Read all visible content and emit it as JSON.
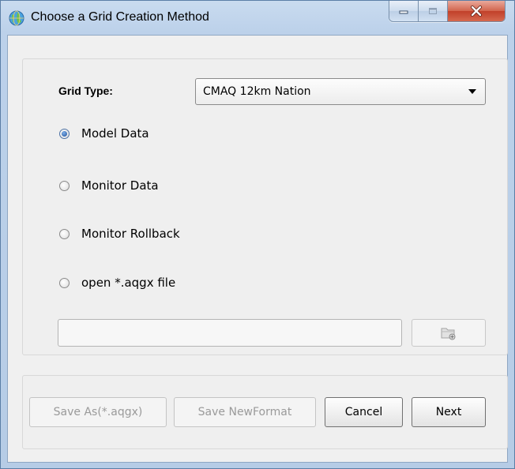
{
  "window": {
    "title": "Choose a Grid Creation Method",
    "icon": "globe-icon",
    "controls": [
      "minimize-icon",
      "maximize-icon",
      "close-icon"
    ]
  },
  "form": {
    "grid_type_label": "Grid Type:",
    "grid_type_value": "CMAQ 12km Nation",
    "options": [
      {
        "label": "Model Data",
        "checked": true
      },
      {
        "label": "Monitor Data",
        "checked": false
      },
      {
        "label": "Monitor Rollback",
        "checked": false
      },
      {
        "label": "open *.aqgx file",
        "checked": false
      }
    ],
    "file_path_value": "",
    "browse_icon": "folder-open-icon"
  },
  "buttons": {
    "save_as": {
      "label": "Save As(*.aqgx)",
      "enabled": false
    },
    "save_newformat": {
      "label": "Save NewFormat",
      "enabled": false
    },
    "cancel": {
      "label": "Cancel",
      "enabled": true
    },
    "next": {
      "label": "Next",
      "enabled": true
    }
  },
  "colors": {
    "title_bar": "#bcd1ea",
    "close_button": "#c1402a",
    "radio_selected": "#1e4f98"
  }
}
